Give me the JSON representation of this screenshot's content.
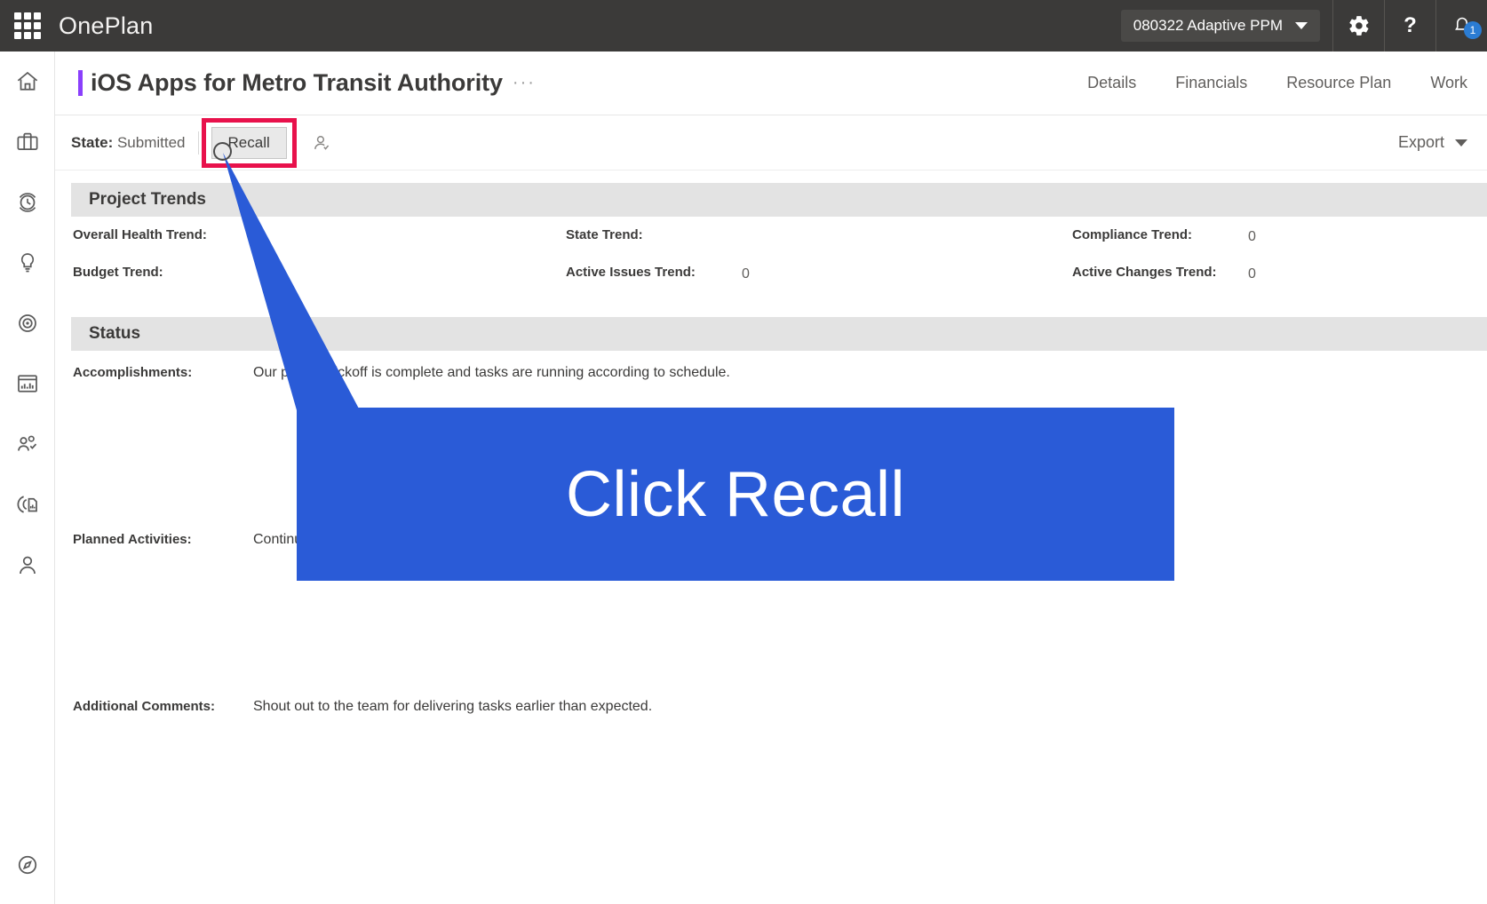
{
  "topbar": {
    "app_name": "OnePlan",
    "waffle_icon": "app-launcher-icon",
    "workspace": "080322 Adaptive PPM",
    "settings_icon": "gear-icon",
    "help_icon": "question-mark-icon",
    "notifications_icon": "bell-icon",
    "notification_count": "1",
    "badge_color": "#2b7cd3"
  },
  "rail": {
    "items": [
      {
        "icon": "home-icon"
      },
      {
        "icon": "briefcase-icon"
      },
      {
        "icon": "timesheet-clock-icon"
      },
      {
        "icon": "lightbulb-idea-icon"
      },
      {
        "icon": "target-goal-icon"
      },
      {
        "icon": "bar-chart-icon"
      },
      {
        "icon": "people-approval-icon"
      },
      {
        "icon": "report-document-icon"
      },
      {
        "icon": "user-person-icon"
      }
    ],
    "bottom_item": {
      "icon": "compass-icon"
    }
  },
  "page_header": {
    "title": "iOS Apps for Metro Transit Authority",
    "ellipsis": "···",
    "accent_color": "#8a3ffc",
    "tabs": [
      {
        "label": "Details"
      },
      {
        "label": "Financials"
      },
      {
        "label": "Resource Plan"
      },
      {
        "label": "Work"
      }
    ]
  },
  "command_bar": {
    "state_label": "State:",
    "state_value": "Submitted",
    "recall_label": "Recall",
    "approver_icon": "person-approver-icon",
    "highlight_color": "#e8114b",
    "export_label": "Export"
  },
  "project_trends": {
    "heading": "Project Trends",
    "rows": [
      [
        {
          "label": "Overall Health Trend:",
          "value": ""
        },
        {
          "label": "State Trend:",
          "value": ""
        },
        {
          "label": "Compliance Trend:",
          "value": "0"
        }
      ],
      [
        {
          "label": "Budget Trend:",
          "value": ""
        },
        {
          "label": "Active Issues Trend:",
          "value": "0"
        },
        {
          "label": "Active Changes Trend:",
          "value": "0"
        }
      ]
    ]
  },
  "status": {
    "heading": "Status",
    "accomplishments_label": "Accomplishments:",
    "accomplishments_value": "Our project kickoff is complete and tasks are running according to schedule.",
    "planned_label": "Planned Activities:",
    "planned_value": "Continue",
    "comments_label": "Additional Comments:",
    "comments_value": "Shout out to the team for delivering tasks earlier than expected."
  },
  "callout": {
    "text": "Click Recall",
    "color": "#2a5bd7"
  }
}
